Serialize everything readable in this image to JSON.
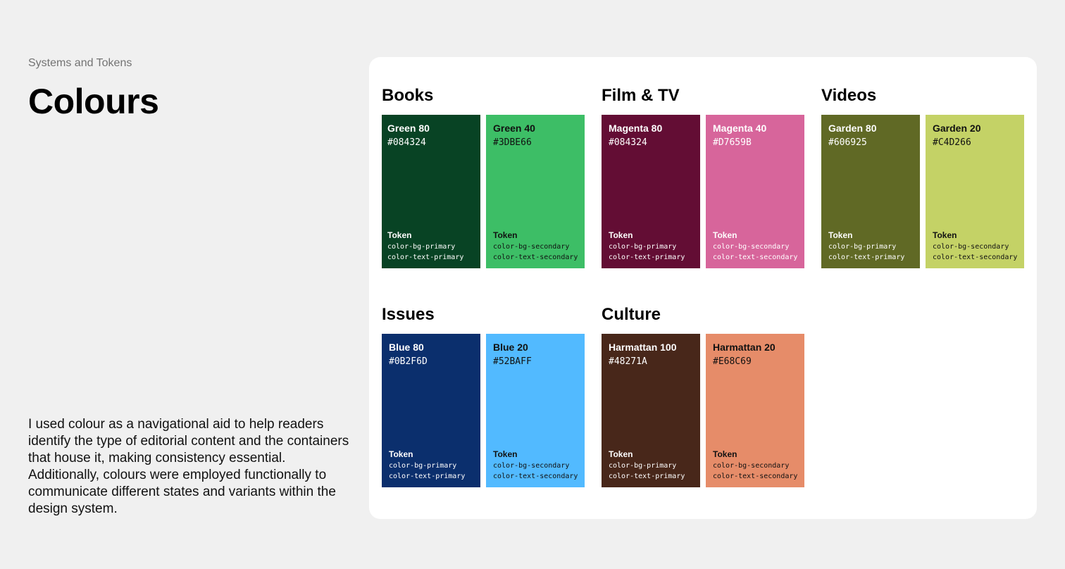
{
  "header": {
    "eyebrow": "Systems and Tokens",
    "title": "Colours"
  },
  "description": "I used colour as a navigational aid to help readers identify the type of editorial content and the containers that house it, making consistency essential. Additionally, colours were employed functionally to communicate different states and variants within the design system.",
  "groups": {
    "books": {
      "title": "Books",
      "swatches": [
        {
          "name": "Green 80",
          "hex": "#084324",
          "color": "#084324",
          "token_label": "Token",
          "tokens": [
            "color-bg-primary",
            "color-text-primary"
          ]
        },
        {
          "name": "Green 40",
          "hex": "#3DBE66",
          "color": "#3DBE66",
          "token_label": "Token",
          "tokens": [
            "color-bg-secondary",
            "color-text-secondary"
          ]
        }
      ]
    },
    "film_tv": {
      "title": "Film & TV",
      "swatches": [
        {
          "name": "Magenta 80",
          "hex": "#084324",
          "color": "#630D34",
          "token_label": "Token",
          "tokens": [
            "color-bg-primary",
            "color-text-primary"
          ]
        },
        {
          "name": "Magenta 40",
          "hex": "#D7659B",
          "color": "#D7659B",
          "token_label": "Token",
          "tokens": [
            "color-bg-secondary",
            "color-text-secondary"
          ]
        }
      ]
    },
    "videos": {
      "title": "Videos",
      "swatches": [
        {
          "name": "Garden 80",
          "hex": "#606925",
          "color": "#606925",
          "token_label": "Token",
          "tokens": [
            "color-bg-primary",
            "color-text-primary"
          ]
        },
        {
          "name": "Garden 20",
          "hex": "#C4D266",
          "color": "#C4D266",
          "token_label": "Token",
          "tokens": [
            "color-bg-secondary",
            "color-text-secondary"
          ]
        }
      ]
    },
    "issues": {
      "title": "Issues",
      "swatches": [
        {
          "name": "Blue 80",
          "hex": "#0B2F6D",
          "color": "#0B2F6D",
          "token_label": "Token",
          "tokens": [
            "color-bg-primary",
            "color-text-primary"
          ]
        },
        {
          "name": "Blue 20",
          "hex": "#52BAFF",
          "color": "#52BAFF",
          "token_label": "Token",
          "tokens": [
            "color-bg-secondary",
            "color-text-secondary"
          ]
        }
      ]
    },
    "culture": {
      "title": "Culture",
      "swatches": [
        {
          "name": "Harmattan 100",
          "hex": "#48271A",
          "color": "#48271A",
          "token_label": "Token",
          "tokens": [
            "color-bg-primary",
            "color-text-primary"
          ]
        },
        {
          "name": "Harmattan 20",
          "hex": "#E68C69",
          "color": "#E68C69",
          "token_label": "Token",
          "tokens": [
            "color-bg-secondary",
            "color-text-secondary"
          ]
        }
      ]
    }
  }
}
